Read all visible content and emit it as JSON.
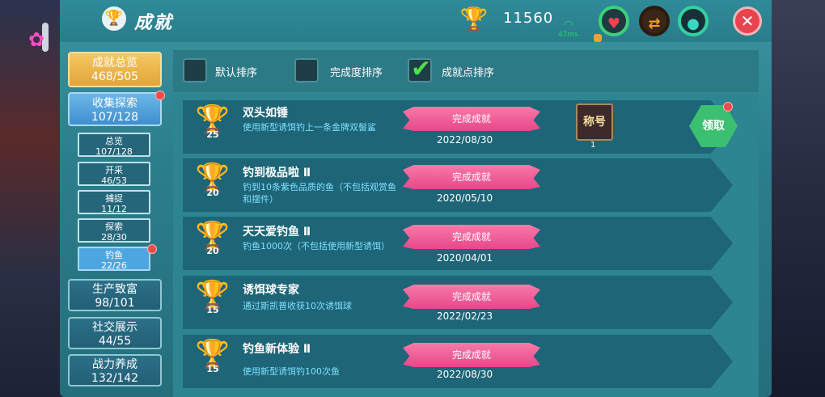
{
  "header": {
    "title": "成就",
    "points": "11560",
    "ping": "47ms"
  },
  "icons": {
    "title": "trophy-icon",
    "points": "gold-trophy-icon",
    "signal": "wifi-signal-icon",
    "heart": "heart-icon",
    "swap": "swap-icon",
    "drop": "water-drop-icon",
    "close": "close-icon"
  },
  "sidebar": {
    "overview": {
      "label": "成就总览",
      "count": "468/505"
    },
    "collect": {
      "label": "收集探索",
      "count": "107/128"
    },
    "sub": [
      {
        "label": "总览",
        "count": "107/128"
      },
      {
        "label": "开采",
        "count": "46/53"
      },
      {
        "label": "捕捉",
        "count": "11/12"
      },
      {
        "label": "探索",
        "count": "28/30"
      },
      {
        "label": "钓鱼",
        "count": "22/26"
      }
    ],
    "categories": [
      {
        "label": "生产致富",
        "count": "98/101"
      },
      {
        "label": "社交展示",
        "count": "44/55"
      },
      {
        "label": "战力养成",
        "count": "132/142"
      }
    ]
  },
  "sort": {
    "default": "默认排序",
    "completion": "完成度排序",
    "points": "成就点排序"
  },
  "achievements": [
    {
      "name": "双头如锤",
      "desc": "使用新型诱饵钓上一条金牌双髻鲨",
      "points": "25",
      "status": "完成成就",
      "date": "2022/08/30",
      "tier": "gold"
    },
    {
      "name": "钓到极品啦 Ⅱ",
      "desc": "钓到10条紫色品质的鱼（不包括观赏鱼和摆件）",
      "points": "20",
      "status": "完成成就",
      "date": "2020/05/10",
      "tier": "purple"
    },
    {
      "name": "天天爱钓鱼 Ⅱ",
      "desc": "钓鱼1000次（不包括使用新型诱饵）",
      "points": "20",
      "status": "完成成就",
      "date": "2020/04/01",
      "tier": "purple"
    },
    {
      "name": "诱饵球专家",
      "desc": "通过斯凯普收获10次诱饵球",
      "points": "15",
      "status": "完成成就",
      "date": "2022/02/23",
      "tier": "bronze"
    },
    {
      "name": "钓鱼新体验 Ⅱ",
      "desc": "使用新型诱饵钓100次鱼",
      "points": "15",
      "status": "完成成就",
      "date": "2022/08/30",
      "tier": "bronze"
    }
  ],
  "reward": {
    "label": "称号",
    "count": "1"
  },
  "claim": "领取",
  "colors": {
    "panel": "#2c7e8c",
    "gold": "#f2c230",
    "ribbon": "#e8478a",
    "claim": "#3ac070",
    "close": "#e8434f"
  }
}
